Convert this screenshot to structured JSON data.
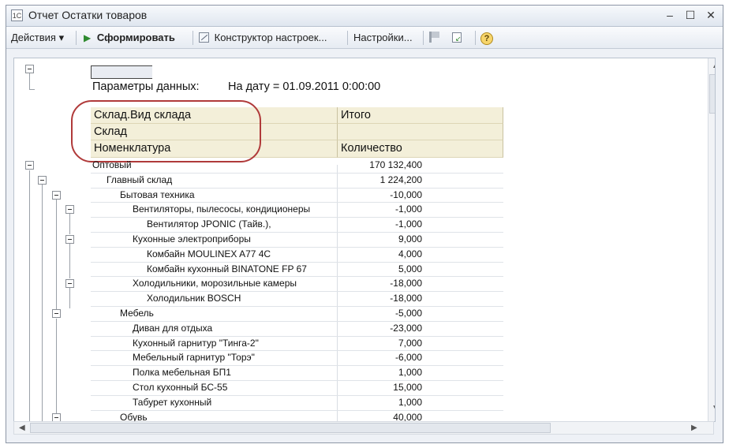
{
  "window": {
    "title": "Отчет  Остатки товаров",
    "app_icon_text": "1С"
  },
  "toolbar": {
    "actions_label": "Действия ▾",
    "generate_label": "Сформировать",
    "constructor_label": "Конструктор настроек...",
    "settings_label": "Настройки..."
  },
  "report": {
    "params_label": "Параметры данных:",
    "params_value": "На дату = 01.09.2011 0:00:00",
    "header": {
      "row1": "Склад.Вид склада",
      "row2": "Склад",
      "row3": "Номенклатура",
      "total": "Итого",
      "quantity": "Количество"
    },
    "rows": [
      {
        "label": "Оптовый",
        "value": "170 132,400"
      },
      {
        "label": "Главный склад",
        "value": "1 224,200"
      },
      {
        "label": "Бытовая техника",
        "value": "-10,000"
      },
      {
        "label": "Вентиляторы, пылесосы, кондиционеры",
        "value": "-1,000"
      },
      {
        "label": "Вентилятор JPONIC (Тайв.),",
        "value": "-1,000"
      },
      {
        "label": "Кухонные электроприборы",
        "value": "9,000"
      },
      {
        "label": "Комбайн MOULINEX  A77 4C",
        "value": "4,000"
      },
      {
        "label": "Комбайн кухонный BINATONE FP 67",
        "value": "5,000"
      },
      {
        "label": "Холодильники, морозильные камеры",
        "value": "-18,000"
      },
      {
        "label": "Холодильник BOSCH",
        "value": "-18,000"
      },
      {
        "label": "Мебель",
        "value": "-5,000"
      },
      {
        "label": "Диван для отдыха",
        "value": "-23,000"
      },
      {
        "label": "Кухонный гарнитур \"Тинга-2\"",
        "value": "7,000"
      },
      {
        "label": "Мебельный гарнитур \"Торэ\"",
        "value": "-6,000"
      },
      {
        "label": "Полка мебельная БП1",
        "value": "1,000"
      },
      {
        "label": "Стол кухонный БС-55",
        "value": "15,000"
      },
      {
        "label": "Табурет кухонный",
        "value": "1,000"
      },
      {
        "label": "Обувь",
        "value": "40,000"
      }
    ]
  },
  "colors": {
    "header_bg": "#f3efd9",
    "highlight_oval": "#b03a3a",
    "play_icon": "#2f8a2f"
  }
}
